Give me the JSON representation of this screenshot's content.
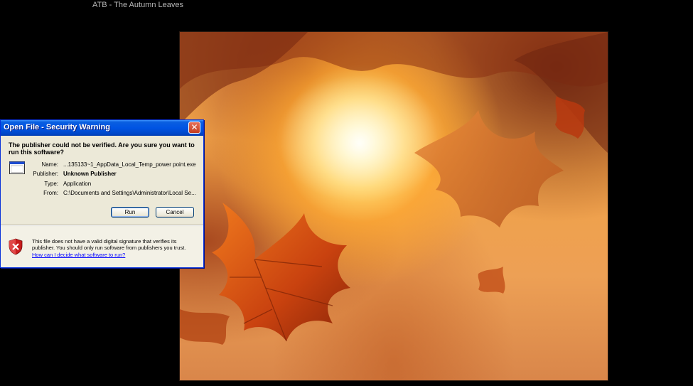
{
  "window": {
    "title": "ATB - The Autumn Leaves"
  },
  "dialog": {
    "title": "Open File - Security Warning",
    "close_glyph": "✕",
    "heading": "The publisher could not be verified.  Are you sure you want to run this software?",
    "fields": [
      {
        "label": "Name:",
        "value": "...135133~1_AppData_Local_Temp_power point.exe"
      },
      {
        "label": "Publisher:",
        "value": "Unknown Publisher"
      },
      {
        "label": "Type:",
        "value": "Application"
      },
      {
        "label": "From:",
        "value": "C:\\Documents and Settings\\Administrator\\Local Se..."
      }
    ],
    "run_label": "Run",
    "cancel_label": "Cancel",
    "note": "This file does not have a valid digital signature that verifies its publisher.  You should only run software from publishers you trust.",
    "help_link": "How can I decide what software to run?"
  },
  "icons": {
    "file": "application-file-icon",
    "shield": "security-shield-icon",
    "close": "close-icon"
  },
  "colors": {
    "titlebar": "#0054e3",
    "dialog_bg": "#ece9d8",
    "link": "#0000ff"
  }
}
